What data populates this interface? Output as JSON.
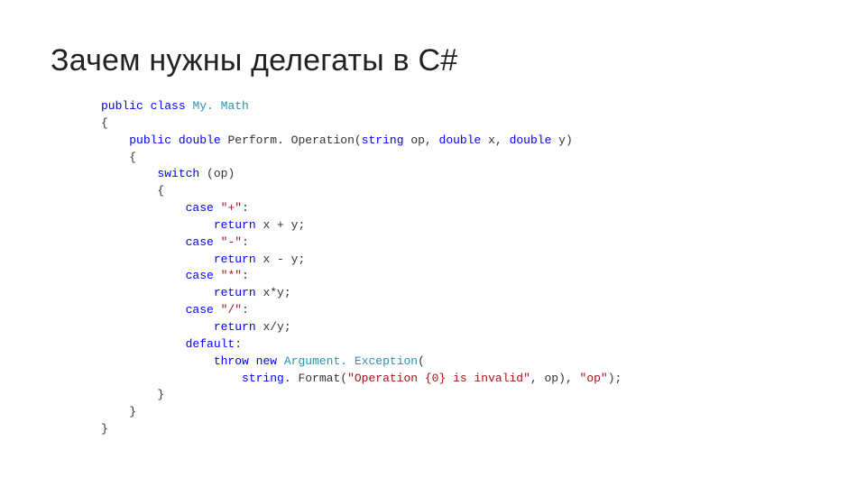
{
  "slide": {
    "title": "Зачем нужны делегаты в C#"
  },
  "code": {
    "tokens": {
      "public1": "public",
      "class": "class",
      "MyMath": "My. Math",
      "lbrace1": "{",
      "public2": "public",
      "double1": "double",
      "PerformOp": "Perform. Operation(",
      "string": "string",
      "paramOp": " op, ",
      "double2": "double",
      "paramX": " x, ",
      "double3": "double",
      "paramY": " y)",
      "lbrace2": "{",
      "switch": "switch",
      "switchExpr": " (op)",
      "lbrace3": "{",
      "case1": "case",
      "str1": " \"+\"",
      "colon1": ":",
      "return1": "return",
      "ret1Expr": " x + y;",
      "case2": "case",
      "str2": " \"-\"",
      "colon2": ":",
      "return2": "return",
      "ret2Expr": " x - y;",
      "case3": "case",
      "str3": " \"*\"",
      "colon3": ":",
      "return3": "return",
      "ret3Expr": " x*y;",
      "case4": "case",
      "str4": " \"/\"",
      "colon4": ":",
      "return4": "return",
      "ret4Expr": " x/y;",
      "default": "default",
      "colon5": ":",
      "throw": "throw",
      "new": "new",
      "ArgEx": "Argument. Exception",
      "paren1": "(",
      "stringClass": "string",
      "format": ". Format(",
      "fmtStr": "\"Operation {0} is invalid\"",
      "fmtArgs": ", op), ",
      "opStr": "\"op\"",
      "close1": ");",
      "rbrace3": "}",
      "rbrace2": "}",
      "rbrace1": "}"
    }
  }
}
